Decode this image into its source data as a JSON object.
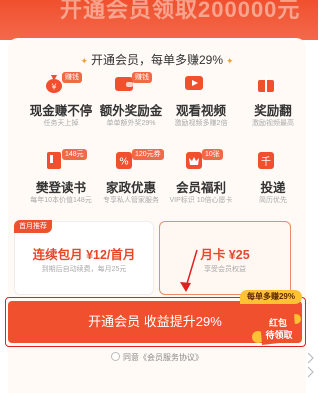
{
  "banner": {
    "headline": "开通会员领取200000元"
  },
  "promo": {
    "text": "开通会员，每单多赚29%"
  },
  "benefits": [
    {
      "title": "现金赚不停",
      "subtitle": "任务天上掉",
      "tag": "赚钱",
      "icon": "money-bag-icon"
    },
    {
      "title": "额外奖励金",
      "subtitle": "单单额外奖29%",
      "tag": "赚钱",
      "icon": "wallet-icon"
    },
    {
      "title": "观看视频",
      "subtitle": "激励视频多赚2倍",
      "tag": "",
      "icon": "video-icon"
    },
    {
      "title": "奖励翻",
      "subtitle": "激励视频最高",
      "tag": "",
      "icon": "gift-icon"
    },
    {
      "title": "樊登读书",
      "subtitle": "每年10本价值148元",
      "tag": "148元",
      "icon": "book-icon"
    },
    {
      "title": "家政优惠",
      "subtitle": "专享私人管家服务",
      "tag": "120元券",
      "icon": "percent-icon"
    },
    {
      "title": "会员福利",
      "subtitle": "VIP标识 10倍心愿卡",
      "tag": "10张",
      "icon": "crown-icon"
    },
    {
      "title": "投递",
      "subtitle": "简历优先",
      "tag": "",
      "icon": "mail-icon"
    }
  ],
  "plans": {
    "left": {
      "badge": "首月推荐",
      "title": "连续包月 ¥12/首月",
      "subtitle": "到期后自动续费，每月25元"
    },
    "right": {
      "title": "月卡 ¥25",
      "subtitle": "享受会员权益"
    }
  },
  "cta": {
    "label": "开通会员 收益提升29%",
    "badge": "每单多赚29%",
    "bag_text": "红包 待领取"
  },
  "agreement": {
    "text": "同意《会员服务协议》"
  },
  "colors": {
    "primary": "#f0502e",
    "accent": "#ffc233",
    "highlight": "#e02020"
  }
}
